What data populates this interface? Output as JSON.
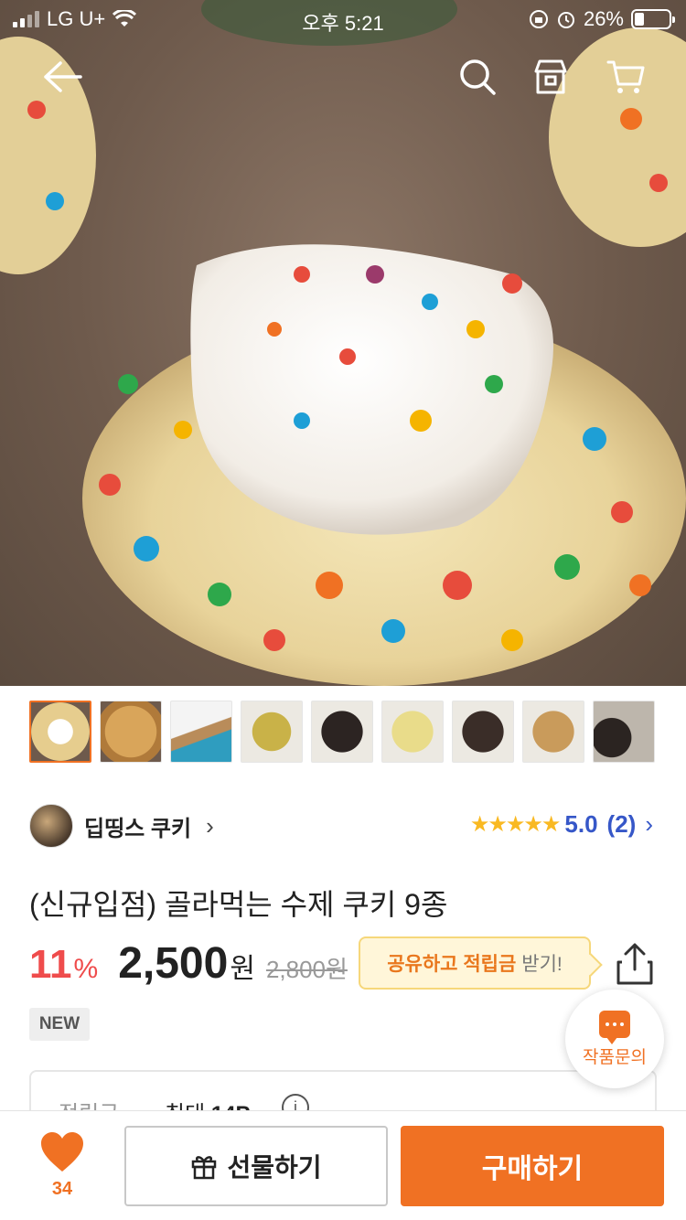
{
  "status_bar": {
    "carrier": "LG U+",
    "time": "오후 5:21",
    "battery": "26%"
  },
  "nav": {
    "back_icon": "back-arrow-icon",
    "search_icon": "search-icon",
    "shop_icon": "shop-icon",
    "cart_icon": "cart-icon"
  },
  "thumbnails": {
    "count": 9,
    "active_index": 0
  },
  "seller": {
    "name": "딥띵스 쿠키"
  },
  "rating": {
    "stars": "★★★★★",
    "score": "5.0",
    "count": "(2)"
  },
  "product": {
    "title": "(신규입점) 골라먹는 수제 쿠키 9종",
    "discount": "11",
    "discount_unit": "%",
    "price": "2,500",
    "price_unit": "원",
    "original_price": "2,800원"
  },
  "share_tooltip": {
    "highlight": "공유하고 적립금",
    "rest": "받기!"
  },
  "badge": "NEW",
  "inquiry": {
    "label": "작품문의"
  },
  "points": {
    "label": "적립금",
    "value_prefix": "최대 ",
    "value": "14P"
  },
  "bottom_bar": {
    "like_count": "34",
    "gift_label": "선물하기",
    "buy_label": "구매하기"
  },
  "colors": {
    "accent": "#f07123",
    "discount": "#ef4c4c",
    "rating": "#3657c8",
    "star": "#f9b922"
  }
}
